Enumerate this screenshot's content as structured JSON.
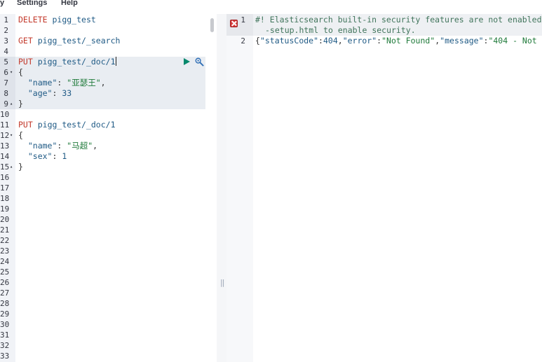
{
  "menu": {
    "history": "y",
    "settings": "Settings",
    "help": "Help"
  },
  "editor": {
    "line_numbers": [
      "1",
      "2",
      "3",
      "4",
      "5",
      "6",
      "7",
      "8",
      "9",
      "10",
      "11",
      "12",
      "13",
      "14",
      "15",
      "16",
      "17",
      "18",
      "19",
      "20",
      "21",
      "22",
      "23",
      "24",
      "25",
      "26",
      "27",
      "28",
      "29",
      "30",
      "31",
      "32",
      "33"
    ],
    "lines": [
      {
        "method": "DELETE",
        "path": "pigg_test"
      },
      {
        "method": "GET",
        "path": "pigg_test/_search"
      },
      {
        "method": "PUT",
        "path": "pigg_test/_doc/1"
      },
      {
        "text": "{"
      },
      {
        "key": "\"name\"",
        "val": "\"亚瑟王\"",
        "trail": ","
      },
      {
        "key": "\"age\"",
        "val": "33",
        "trail": ""
      },
      {
        "text": "}"
      },
      {
        "method": "PUT",
        "path": "pigg_test/_doc/1"
      },
      {
        "text": "{"
      },
      {
        "key": "\"name\"",
        "val": "\"马超\"",
        "trail": ","
      },
      {
        "key": "\"sex\"",
        "val": "1",
        "trail": ""
      },
      {
        "text": "}"
      }
    ]
  },
  "output": {
    "line_numbers": [
      "1",
      "2"
    ],
    "comment_1": "#! Elasticsearch built-in security features are not enabled",
    "comment_1_wrap": "-setup.html to enable security.",
    "l2_open": "{",
    "l2_k1": "\"statusCode\"",
    "l2_v1": "404",
    "l2_k2": "\"error\"",
    "l2_v2": "\"Not Found\"",
    "l2_k3": "\"message\"",
    "l2_v3": "\"404 - Not"
  },
  "divider_handle": "||"
}
